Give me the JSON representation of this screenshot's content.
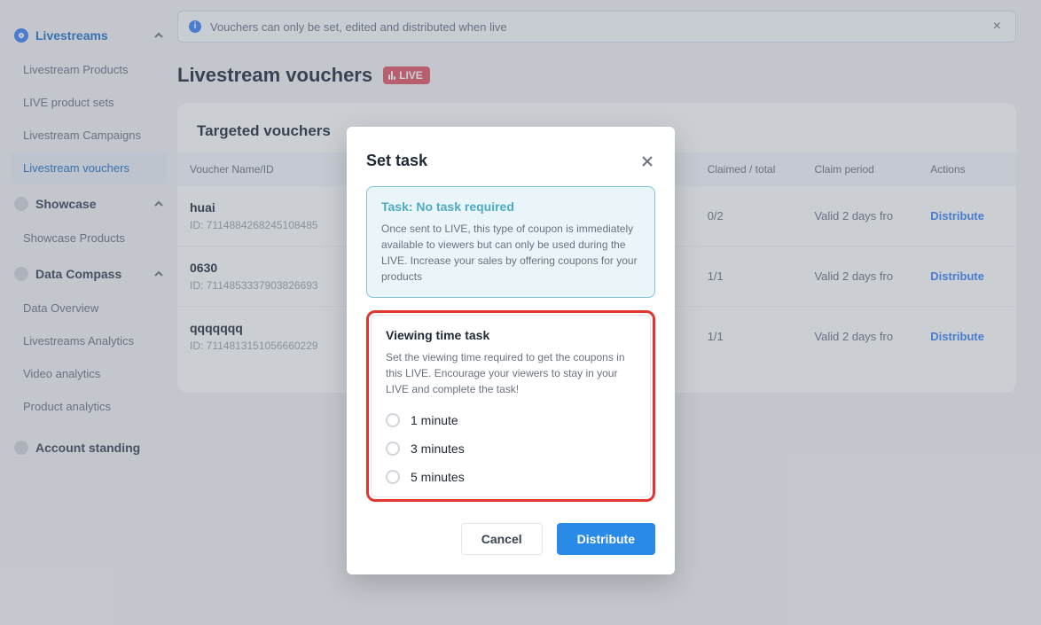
{
  "alert": {
    "message": "Vouchers can only be set, edited and distributed when live"
  },
  "page": {
    "title": "Livestream vouchers",
    "live_badge": "LIVE"
  },
  "sidebar": {
    "sections": [
      {
        "label": "Livestreams",
        "items": [
          {
            "label": "Livestream Products"
          },
          {
            "label": "LIVE product sets"
          },
          {
            "label": "Livestream Campaigns"
          },
          {
            "label": "Livestream vouchers"
          }
        ]
      },
      {
        "label": "Showcase",
        "items": [
          {
            "label": "Showcase Products"
          }
        ]
      },
      {
        "label": "Data Compass",
        "items": [
          {
            "label": "Data Overview"
          },
          {
            "label": "Livestreams Analytics"
          },
          {
            "label": "Video analytics"
          },
          {
            "label": "Product analytics"
          }
        ]
      }
    ],
    "account": "Account standing"
  },
  "table": {
    "heading": "Targeted vouchers",
    "columns": {
      "name": "Voucher Name/ID",
      "claimed": "Claimed / total",
      "period": "Claim period",
      "actions": "Actions"
    },
    "rows": [
      {
        "name": "huai",
        "id": "ID: 7114884268245108485",
        "claimed": "0/2",
        "period": "Valid 2 days fro",
        "action": "Distribute"
      },
      {
        "name": "0630",
        "id": "ID: 7114853337903826693",
        "claimed": "1/1",
        "period": "Valid 2 days fro",
        "action": "Distribute"
      },
      {
        "name": "qqqqqqq",
        "id": "ID: 7114813151056660229",
        "claimed": "1/1",
        "period": "Valid 2 days fro",
        "action": "Distribute"
      }
    ]
  },
  "modal": {
    "title": "Set task",
    "no_task": {
      "title": "Task: No task required",
      "desc": "Once sent to LIVE, this type of coupon is immediately available to viewers but can only be used during the LIVE. Increase your sales by offering coupons for your products"
    },
    "view_task": {
      "title": "Viewing time task",
      "desc": "Set the viewing time required to get the coupons in this LIVE. Encourage your viewers to stay in your LIVE and complete the task!",
      "options": [
        "1 minute",
        "3 minutes",
        "5 minutes"
      ]
    },
    "cancel": "Cancel",
    "distribute": "Distribute"
  }
}
